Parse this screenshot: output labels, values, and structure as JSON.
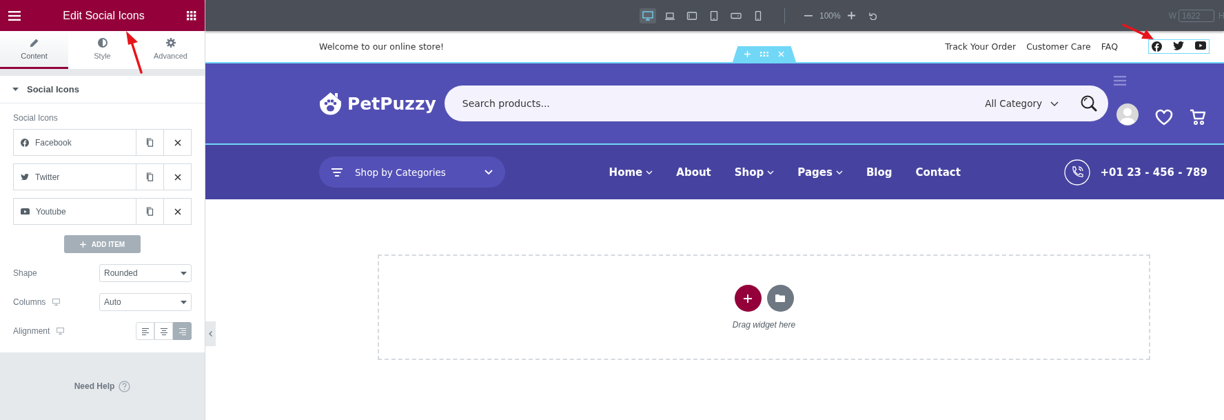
{
  "panel": {
    "title": "Edit Social Icons",
    "tabs": [
      {
        "label": "Content",
        "selected": true
      },
      {
        "label": "Style",
        "selected": false
      },
      {
        "label": "Advanced",
        "selected": false
      }
    ],
    "section": {
      "title": "Social Icons",
      "expanded": true
    },
    "repeater_label": "Social Icons",
    "items": [
      {
        "label": "Facebook"
      },
      {
        "label": "Twitter"
      },
      {
        "label": "Youtube"
      }
    ],
    "add_button": "ADD ITEM",
    "controls": [
      {
        "kind": "select",
        "label": "Shape",
        "responsive": false,
        "value": "Rounded"
      },
      {
        "kind": "select",
        "label": "Columns",
        "responsive": true,
        "value": "Auto"
      },
      {
        "kind": "align",
        "label": "Alignment",
        "responsive": true,
        "options": [
          {
            "selected": false
          },
          {
            "selected": false
          },
          {
            "selected": true
          }
        ]
      }
    ],
    "help": "Need Help"
  },
  "toolbar": {
    "devices": [
      {
        "selected": true
      },
      {
        "selected": false
      },
      {
        "selected": false
      },
      {
        "selected": false
      },
      {
        "selected": false
      },
      {
        "selected": false
      }
    ],
    "zoom": "100%",
    "width_label": "W",
    "width_value": "1622",
    "height_label": "H"
  },
  "site": {
    "top_bar": {
      "welcome": "Welcome to our online store!",
      "links": [
        "Track Your Order",
        "Customer Care",
        "FAQ"
      ],
      "social_selected": true
    },
    "header": {
      "logo": "PetPuzzy",
      "search_placeholder": "Search products...",
      "category": "All Category"
    },
    "nav": {
      "categories": "Shop by Categories",
      "menu": [
        {
          "label": "Home",
          "dropdown": true
        },
        {
          "label": "About",
          "dropdown": false
        },
        {
          "label": "Shop",
          "dropdown": true
        },
        {
          "label": "Pages",
          "dropdown": true
        },
        {
          "label": "Blog",
          "dropdown": false
        },
        {
          "label": "Contact",
          "dropdown": false
        }
      ],
      "phone": "+01 23 - 456 - 789"
    },
    "drop_zone": {
      "text": "Drag widget here"
    }
  }
}
